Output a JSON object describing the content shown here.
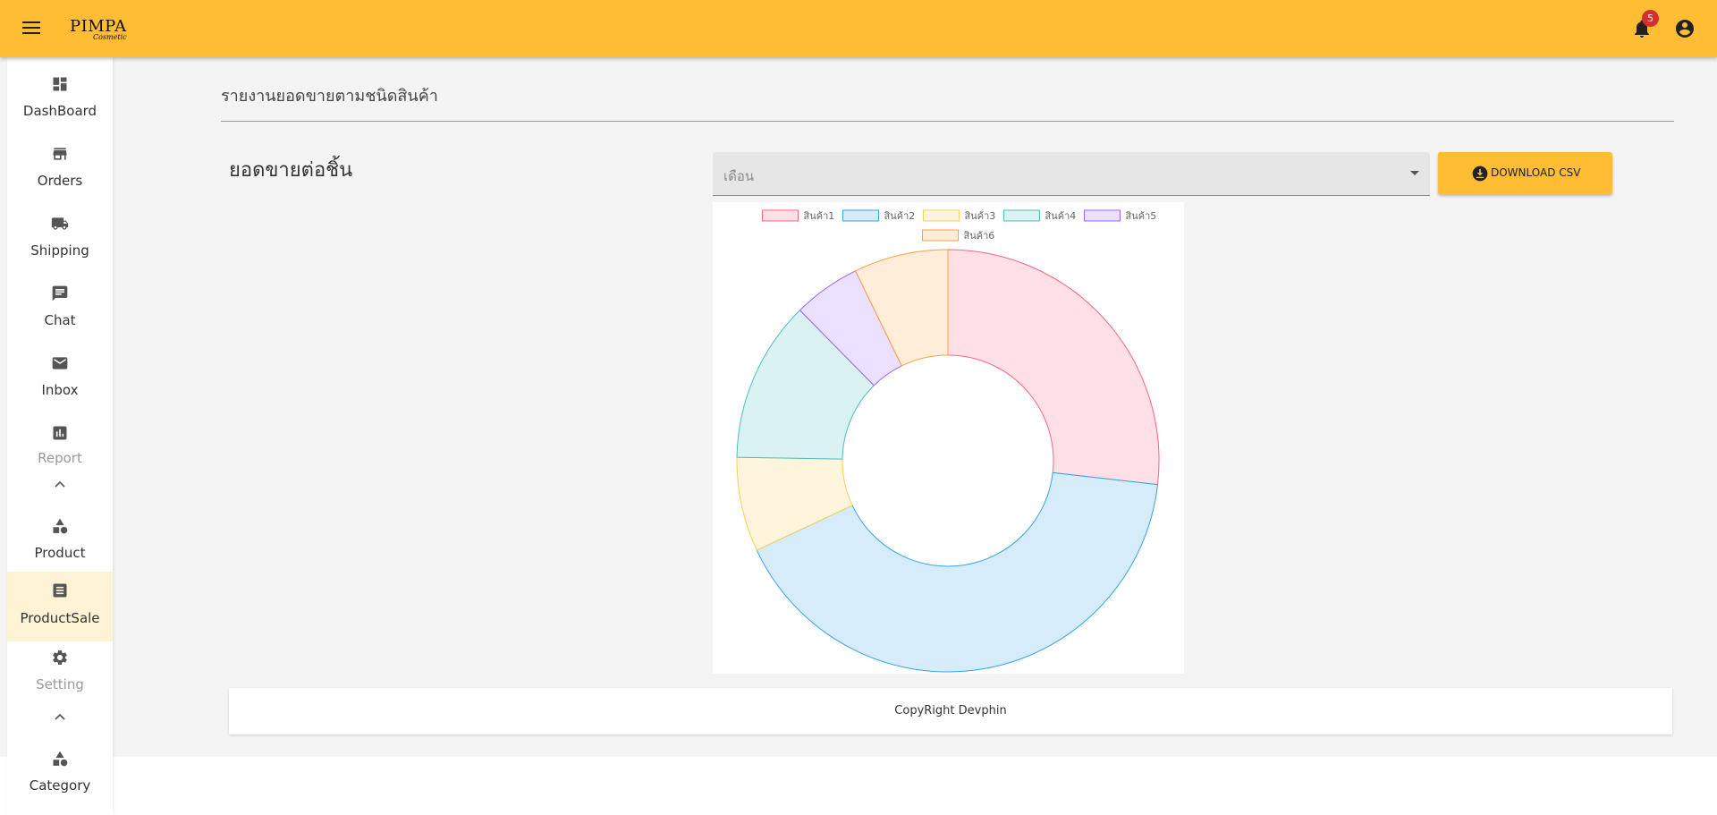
{
  "app": {
    "brand": "PIMPA",
    "brand_sub": "Cosmetic",
    "notification_count": "5",
    "icons": [
      "menu-icon",
      "bell-icon",
      "account-circle-icon"
    ],
    "accent_color": "#FFBD33"
  },
  "sidebar": {
    "items": [
      {
        "label": "DashBoard",
        "icon": "dashboard-icon"
      },
      {
        "label": "Orders",
        "icon": "store-icon"
      },
      {
        "label": "Shipping",
        "icon": "truck-icon"
      },
      {
        "label": "Chat",
        "icon": "chat-icon"
      },
      {
        "label": "Inbox",
        "icon": "mail-icon"
      },
      {
        "label": "Report",
        "icon": "bar-chart-icon"
      },
      {
        "label": "Product",
        "icon": "shapes-icon"
      },
      {
        "label": "ProductSale",
        "icon": "list-alt-icon",
        "active": true
      },
      {
        "label": "Setting",
        "icon": "gear-icon"
      },
      {
        "label": "Category",
        "icon": "shapes-icon"
      }
    ]
  },
  "main": {
    "page_title": "รายงานยอดขายตามชนิดสินค้า",
    "section_title": "ยอดขายต่อชิ้น",
    "month_select": {
      "placeholder": "เดือน"
    },
    "download_label": "DOWNLOAD CSV"
  },
  "chart_data": {
    "type": "pie",
    "variant": "doughnut",
    "legend_position": "top",
    "labels": [
      "สินค้า1",
      "สินค้า2",
      "สินค้า3",
      "สินค้า4",
      "สินค้า5",
      "สินค้า6"
    ],
    "values": [
      26,
      40,
      7,
      12,
      5,
      7
    ],
    "colors": [
      {
        "fill": "#FFE0E6",
        "stroke": "#FF6384"
      },
      {
        "fill": "#D7ECFB",
        "stroke": "#36A2EB"
      },
      {
        "fill": "#FFF5DD",
        "stroke": "#FFCE56"
      },
      {
        "fill": "#DBF2F2",
        "stroke": "#4BC0C0"
      },
      {
        "fill": "#EBE0FF",
        "stroke": "#9966FF"
      },
      {
        "fill": "#FFECD9",
        "stroke": "#FF9F40"
      }
    ]
  },
  "footer": {
    "text": "CopyRight Devphin"
  }
}
